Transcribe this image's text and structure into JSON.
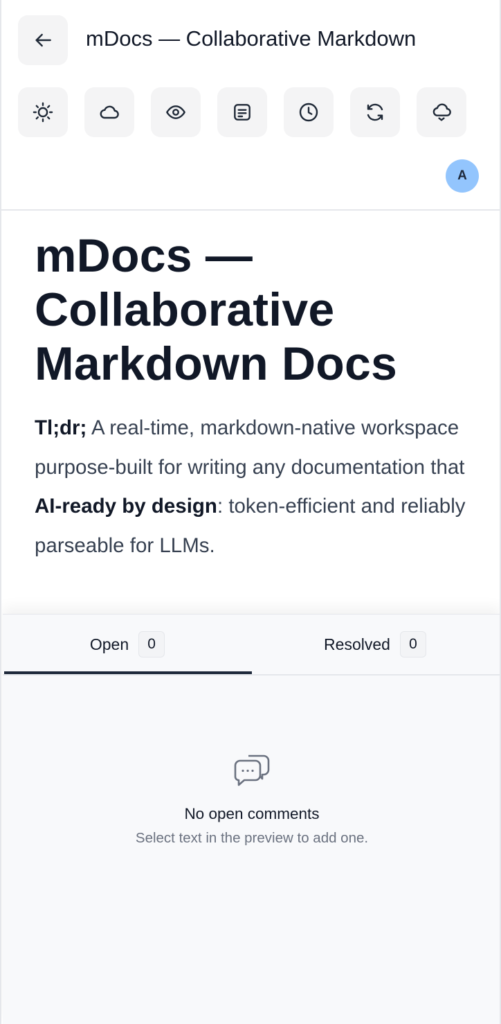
{
  "header": {
    "title": "mDocs — Collaborative Markdown",
    "back_icon": "arrow-left-icon",
    "toolbar": [
      {
        "name": "theme-toggle-button",
        "icon": "sun-icon"
      },
      {
        "name": "cloud-button",
        "icon": "cloud-icon"
      },
      {
        "name": "preview-button",
        "icon": "eye-icon"
      },
      {
        "name": "notes-button",
        "icon": "note-icon"
      },
      {
        "name": "history-button",
        "icon": "clock-icon"
      },
      {
        "name": "sync-button",
        "icon": "refresh-icon"
      },
      {
        "name": "cloud-download-button",
        "icon": "cloud-download-icon"
      }
    ],
    "avatar_initial": "A",
    "avatar_color": "#93c5fd"
  },
  "document": {
    "heading": "mDocs — Collaborative Markdown Docs",
    "intro": {
      "lead_bold": "Tl;dr;",
      "text_before": " A real-time, markdown-native workspace purpose-built for writing any documentation that ",
      "emphasis_bold": "AI-ready by design",
      "text_after": ": token-efficient and reliably parseable for LLMs."
    }
  },
  "comments": {
    "tabs": [
      {
        "label": "Open",
        "count": "0"
      },
      {
        "label": "Resolved",
        "count": "0"
      }
    ],
    "empty_icon": "chat-bubbles-icon",
    "empty_title": "No open comments",
    "empty_subtitle": "Select text in the preview to add one."
  }
}
